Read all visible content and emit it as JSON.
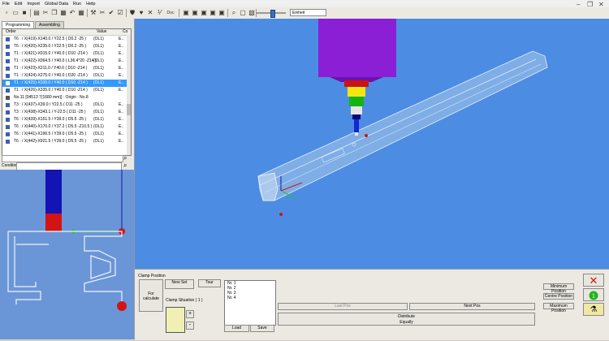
{
  "menu": [
    "File",
    "Edit",
    "Import",
    "Global Data",
    "Run",
    "Help"
  ],
  "toolbar": {
    "doc_label": "Doc",
    "combo_value": "Einheit"
  },
  "tabs": [
    {
      "label": "Programming",
      "active": true
    },
    {
      "label": "Assembling",
      "active": false
    }
  ],
  "list": {
    "headers": [
      "Order",
      "Value",
      "Co"
    ],
    "rows": [
      {
        "text": "T6 : / X(419)-X140.0 / Y22.5  ( D0.2 -25 )",
        "value": "(OL1)",
        "co": "E.."
      },
      {
        "text": "T6 : / X(420)-X235.0 / Y22.5  ( D0.2 -25 )",
        "value": "(OL1)",
        "co": "E.."
      },
      {
        "text": "T1 : / X(421)-X015.0 / Y40.0  ( D10 -Z14 )",
        "value": "(OL1)",
        "co": "E.."
      },
      {
        "text": "T1 : / X(422)-X064.5 / Y40.0  ( L36.4*20 -Z14 )",
        "value": "(OL1)",
        "co": "E.."
      },
      {
        "text": "T1 : / X(423)-X211.0 / Y40.0  ( D10 -Z14 )",
        "value": "(OL1)",
        "co": "E.."
      },
      {
        "text": "T1 : / X(424)-X275.0 / Y40.0  ( D20 -Z14 )",
        "value": "(OL1)",
        "co": "E.."
      },
      {
        "text": "T1 : / X(425)-X330.0 / Y40.0  ( D10 -Z14 )",
        "value": "(OL1)",
        "co": "E..",
        "selected": true
      },
      {
        "text": "T1 : / X(426)-X335.0 / Y40.0  ( D10 -Z14 )",
        "value": "(OL1)",
        "co": "E.."
      },
      {
        "text": "No.11 [04513 7(1680 mm)] : Origin : No.8",
        "value": "",
        "co": "",
        "icon": true
      },
      {
        "text": "T3 : / X(437)-X39.0 / Y22.5  ( D11 -25 )",
        "value": "(OL1)",
        "co": "E.."
      },
      {
        "text": "T3 : / X(438)-X343.1 / Y-22.5  ( D11 -25 )",
        "value": "(OL1)",
        "co": "E.."
      },
      {
        "text": "T6 : / X(439)-X151.5 / Y39.0  ( D5.5 -25 )",
        "value": "(OL1)",
        "co": "E.."
      },
      {
        "text": "T6 : / X(440)-X170.0 / Y37.2  ( D5.5 -Z10.5 )",
        "value": "(OL1)",
        "co": "E.."
      },
      {
        "text": "T6 : / X(441)-X190.5 / Y39.0  ( D5.5 -25 )",
        "value": "(OL1)",
        "co": "E.."
      },
      {
        "text": "T6 : / X(442)-X921.5 / Y39.0  ( D5.5 -25 )",
        "value": "(OL1)",
        "co": "E.."
      }
    ]
  },
  "condition_label": "Condition",
  "clamp": {
    "section_title": "Clamp Position",
    "for_calc": "For calculate",
    "new_set": "New Set",
    "tour": "Tour",
    "situation": "Clamp Situation ( 1 )",
    "plus": "+",
    "minus": "-",
    "items": [
      "Nr. 1",
      "Nr. 2",
      "Nr. 3",
      "Nr. 4"
    ],
    "load": "Load",
    "save": "Save",
    "last_pos": "Last Pos",
    "next_pos": "Next Pos",
    "distribute": "Distribute",
    "equally": "Equally",
    "min_pos": "Minimum Position",
    "center_pos": "Centre Position",
    "max_pos": "Maximum Position"
  },
  "colors": {
    "viewport": "#4c8de3",
    "spindle": "#8a1fd6",
    "selection": "#3399ff"
  }
}
